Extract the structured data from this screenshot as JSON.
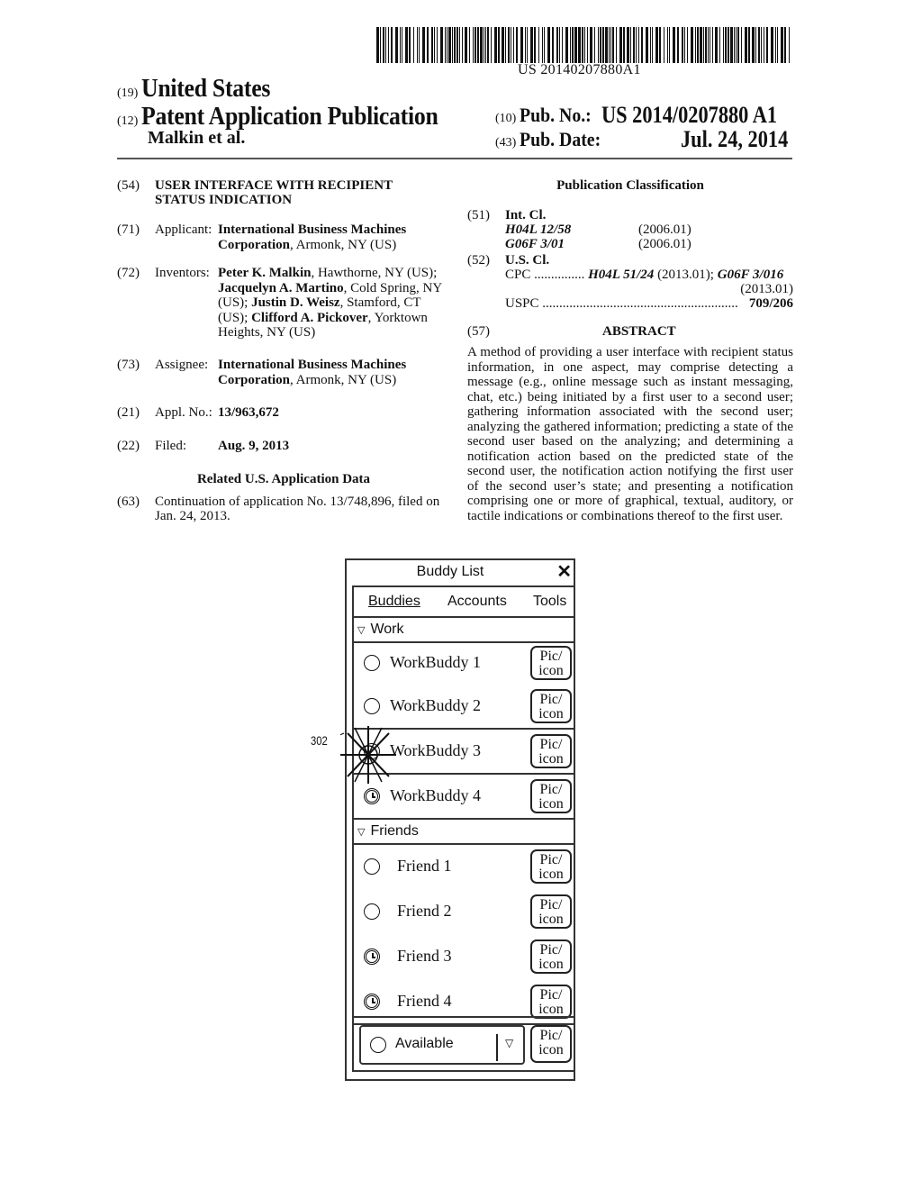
{
  "header": {
    "barcode_number": "US 20140207880A1",
    "country_code": "(19)",
    "country": "United States",
    "kind_code": "(12)",
    "doc_type": "Patent Application Publication",
    "authors": "Malkin et al.",
    "pub_no_code": "(10)",
    "pub_no_label": "Pub. No.:",
    "pub_no": "US 2014/0207880 A1",
    "pub_date_code": "(43)",
    "pub_date_label": "Pub. Date:",
    "pub_date": "Jul. 24, 2014"
  },
  "left": {
    "title_code": "(54)",
    "title_l1": "USER INTERFACE WITH RECIPIENT",
    "title_l2": "STATUS INDICATION",
    "applicant_code": "(71)",
    "applicant_label": "Applicant:",
    "applicant_name_l1": "International Business Machines",
    "applicant_name_l2": "Corporation",
    "applicant_loc": ", Armonk, NY (US)",
    "inventors_code": "(72)",
    "inventors_label": "Inventors:",
    "inventors": [
      {
        "name": "Peter K. Malkin",
        "loc": ", Hawthorne, NY (US);"
      },
      {
        "name": "Jacquelyn A. Martino",
        "loc": ", Cold Spring, NY"
      },
      {
        "pre": "(US); ",
        "name": "Justin D. Weisz",
        "loc": ", Stamford, CT"
      },
      {
        "pre": "(US); ",
        "name": "Clifford A. Pickover",
        "loc": ", Yorktown"
      },
      {
        "loc": "Heights, NY (US)"
      }
    ],
    "assignee_code": "(73)",
    "assignee_label": "Assignee:",
    "assignee_name_l1": "International Business Machines",
    "assignee_name_l2": "Corporation",
    "assignee_loc": ", Armonk, NY (US)",
    "appl_code": "(21)",
    "appl_label": "Appl. No.:",
    "appl_no": "13/963,672",
    "filed_code": "(22)",
    "filed_label": "Filed:",
    "filed": "Aug. 9, 2013",
    "related_title": "Related U.S. Application Data",
    "cont_code": "(63)",
    "cont_l1": "Continuation of application No. 13/748,896, filed on",
    "cont_l2": "Jan. 24, 2013."
  },
  "right": {
    "class_title": "Publication Classification",
    "intcl_code": "(51)",
    "intcl_label": "Int. Cl.",
    "intcl": [
      {
        "code": "H04L 12/58",
        "ver": "(2006.01)"
      },
      {
        "code": "G06F 3/01",
        "ver": "(2006.01)"
      }
    ],
    "uscl_code": "(52)",
    "uscl_label": "U.S. Cl.",
    "cpc_label": "CPC",
    "cpc_dots": "...............",
    "cpc_1": "H04L 51/24",
    "cpc_1_ver": " (2013.01); ",
    "cpc_2": "G06F 3/016",
    "cpc_2_ver": "(2013.01)",
    "uspc_label": "USPC",
    "uspc_dots": "..........................................................",
    "uspc": "709/206",
    "abstract_code": "(57)",
    "abstract_title": "ABSTRACT",
    "abstract": "A method of providing a user interface with recipient status information, in one aspect, may comprise detecting a message (e.g., online message such as instant messaging, chat, etc.) being initiated by a first user to a second user; gathering information associated with the second user; analyzing the gathered information; predicting a state of the second user based on the analyzing; and determining a notification action based on the predicted state of the second user, the notification action notifying the first user of the second user’s state; and presenting a notification comprising one or more of graphical, textual, auditory, or tactile indications or combinations thereof to the first user."
  },
  "figure": {
    "window_title": "Buddy List",
    "close_icon": "✕",
    "menu": [
      "Buddies",
      "Accounts",
      "Tools"
    ],
    "callout": "302",
    "groups": [
      {
        "name": "Work",
        "buddies": [
          {
            "name": "WorkBuddy 1",
            "status": "available",
            "pic": "Pic/ icon"
          },
          {
            "name": "WorkBuddy 2",
            "status": "available",
            "pic": "Pic/ icon"
          },
          {
            "name": "WorkBuddy 3",
            "status": "highlighted",
            "pic": "Pic/ icon"
          },
          {
            "name": "WorkBuddy 4",
            "status": "away",
            "pic": "Pic/ icon"
          }
        ]
      },
      {
        "name": "Friends",
        "buddies": [
          {
            "name": "Friend 1",
            "status": "available",
            "pic": "Pic/ icon"
          },
          {
            "name": "Friend 2",
            "status": "available",
            "pic": "Pic/ icon"
          },
          {
            "name": "Friend 3",
            "status": "away",
            "pic": "Pic/ icon"
          },
          {
            "name": "Friend 4",
            "status": "away",
            "pic": "Pic/ icon"
          }
        ]
      }
    ],
    "my_status": "Available",
    "my_pic": "Pic/ icon",
    "pic_l1": "Pic/",
    "pic_l2": "icon"
  }
}
